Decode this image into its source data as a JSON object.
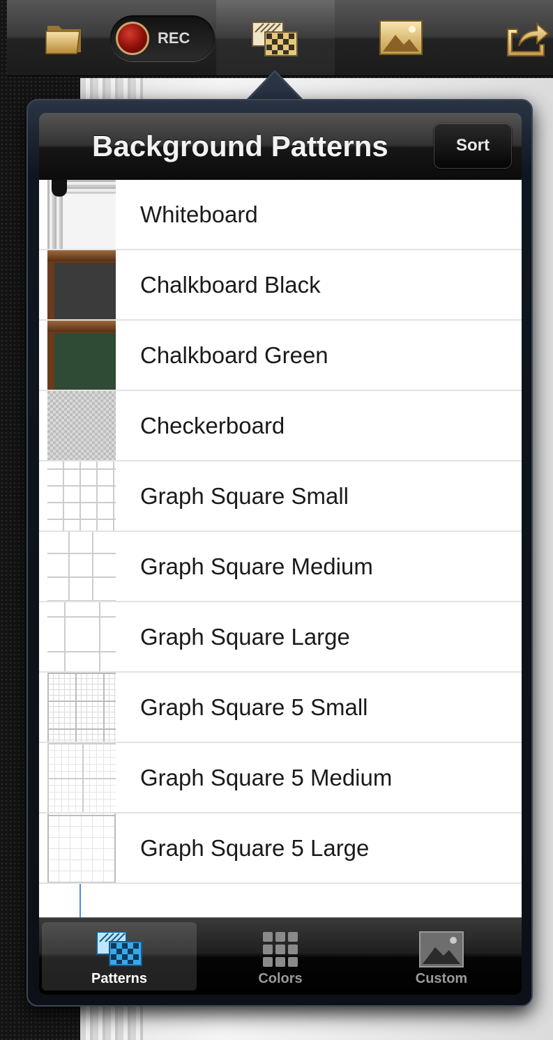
{
  "toolbar": {
    "folder_icon": "folder-icon",
    "rec_label": "REC",
    "patterns_icon": "patterns-icon",
    "image_icon": "image-icon",
    "share_icon": "share-icon"
  },
  "popover": {
    "title": "Background Patterns",
    "sort_label": "Sort",
    "items": [
      {
        "label": "Whiteboard",
        "thumb": "whiteboard"
      },
      {
        "label": "Chalkboard Black",
        "thumb": "chalk-black"
      },
      {
        "label": "Chalkboard Green",
        "thumb": "chalk-green"
      },
      {
        "label": "Checkerboard",
        "thumb": "checker"
      },
      {
        "label": "Graph Square Small",
        "thumb": "grid-s"
      },
      {
        "label": "Graph Square Medium",
        "thumb": "grid-m"
      },
      {
        "label": "Graph Square Large",
        "thumb": "grid-l"
      },
      {
        "label": "Graph Square 5 Small",
        "thumb": "grid5-s"
      },
      {
        "label": "Graph Square 5 Medium",
        "thumb": "grid5-m"
      },
      {
        "label": "Graph Square 5 Large",
        "thumb": "grid5-l"
      },
      {
        "label": "",
        "thumb": "partial"
      }
    ]
  },
  "tabs": {
    "patterns": "Patterns",
    "colors": "Colors",
    "custom": "Custom",
    "active": "patterns"
  },
  "colors": {
    "accent_blue": "#3aa8e8",
    "rec_red": "#b21c14",
    "gold": "#d9b46a"
  }
}
